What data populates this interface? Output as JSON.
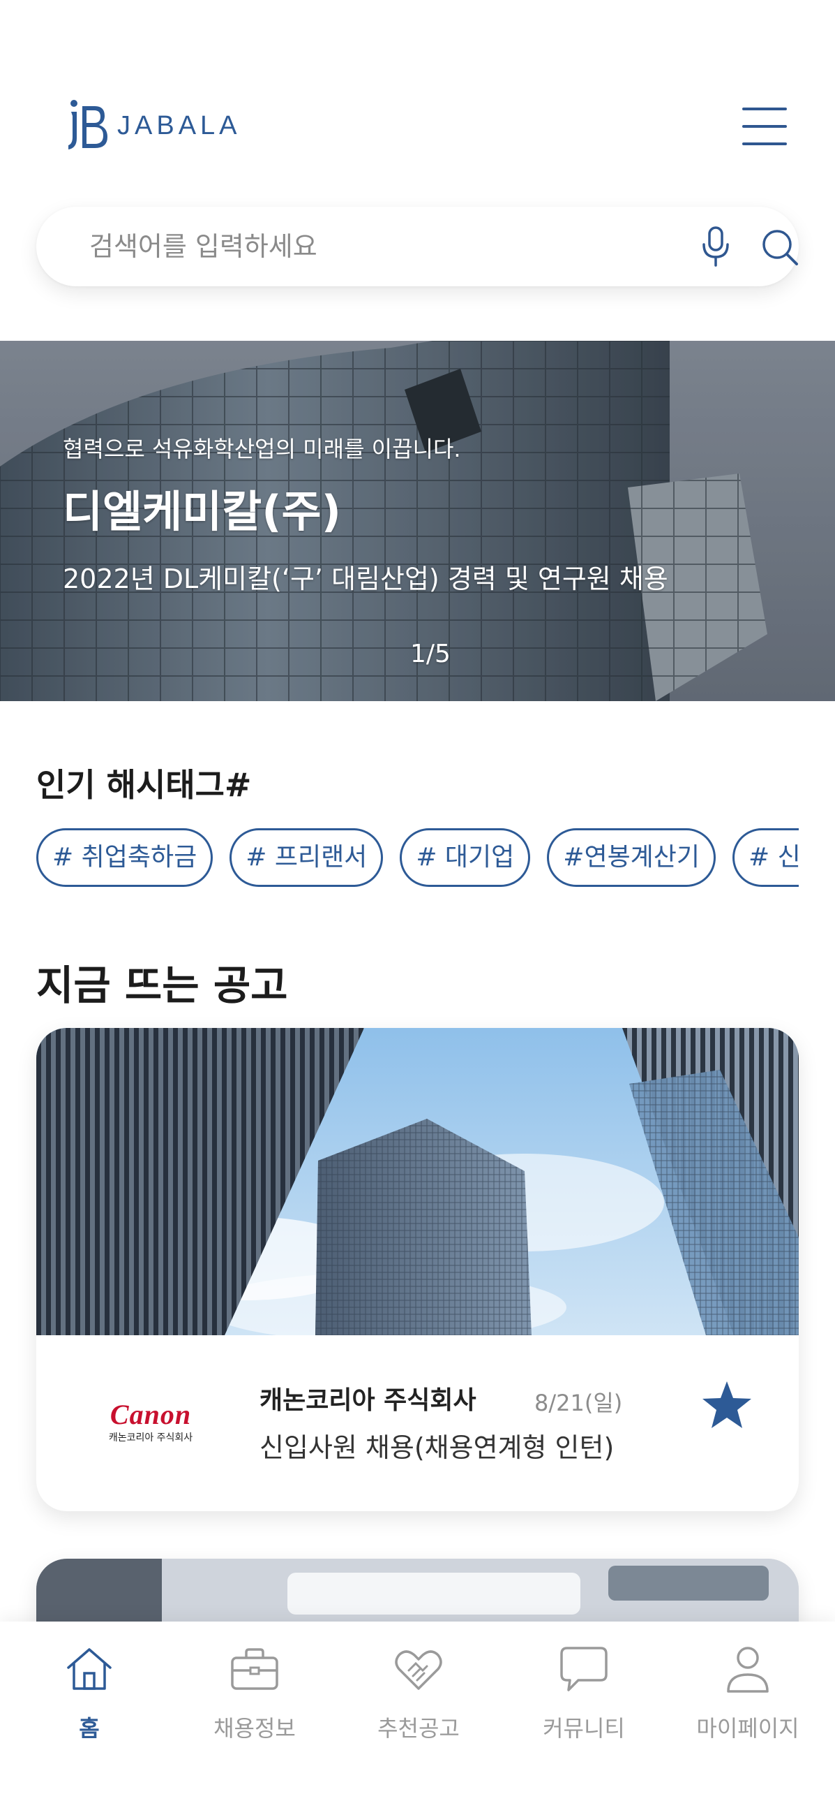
{
  "header": {
    "logo_text": "JABALA",
    "logo_mark": "jB"
  },
  "search": {
    "placeholder": "검색어를 입력하세요",
    "mic_icon": "mic-icon",
    "search_icon": "search-icon"
  },
  "banner": {
    "subtitle": "협력으로 석유화학산업의 미래를 이끕니다.",
    "title": "디엘케미칼(주)",
    "description": "2022년 DL케미칼(‘구’ 대림산업) 경력 및 연구원 채용",
    "pagination": "1/5"
  },
  "hashtags": {
    "title": "인기 해시태그#",
    "items": [
      "# 취업축하금",
      "# 프리랜서",
      "# 대기업",
      "#연봉계산기",
      "# 신입"
    ]
  },
  "hot_jobs": {
    "title": "지금 뜨는 공고",
    "cards": [
      {
        "logo_word": "Canon",
        "logo_sub": "캐논코리아 주식회사",
        "company": "캐논코리아 주식회사",
        "date": "8/21(일)",
        "role": "신입사원 채용(채용연계형 인턴)",
        "favorited": true
      }
    ]
  },
  "bottom_nav": {
    "items": [
      {
        "label": "홈",
        "icon": "home-icon",
        "active": true
      },
      {
        "label": "채용정보",
        "icon": "briefcase-icon",
        "active": false
      },
      {
        "label": "추천공고",
        "icon": "handshake-heart-icon",
        "active": false
      },
      {
        "label": "커뮤니티",
        "icon": "chat-bubble-icon",
        "active": false
      },
      {
        "label": "마이페이지",
        "icon": "user-icon",
        "active": false
      }
    ]
  },
  "colors": {
    "brand": "#2d5a96",
    "inactive": "#9a9a9a",
    "canon_red": "#c8102e"
  }
}
